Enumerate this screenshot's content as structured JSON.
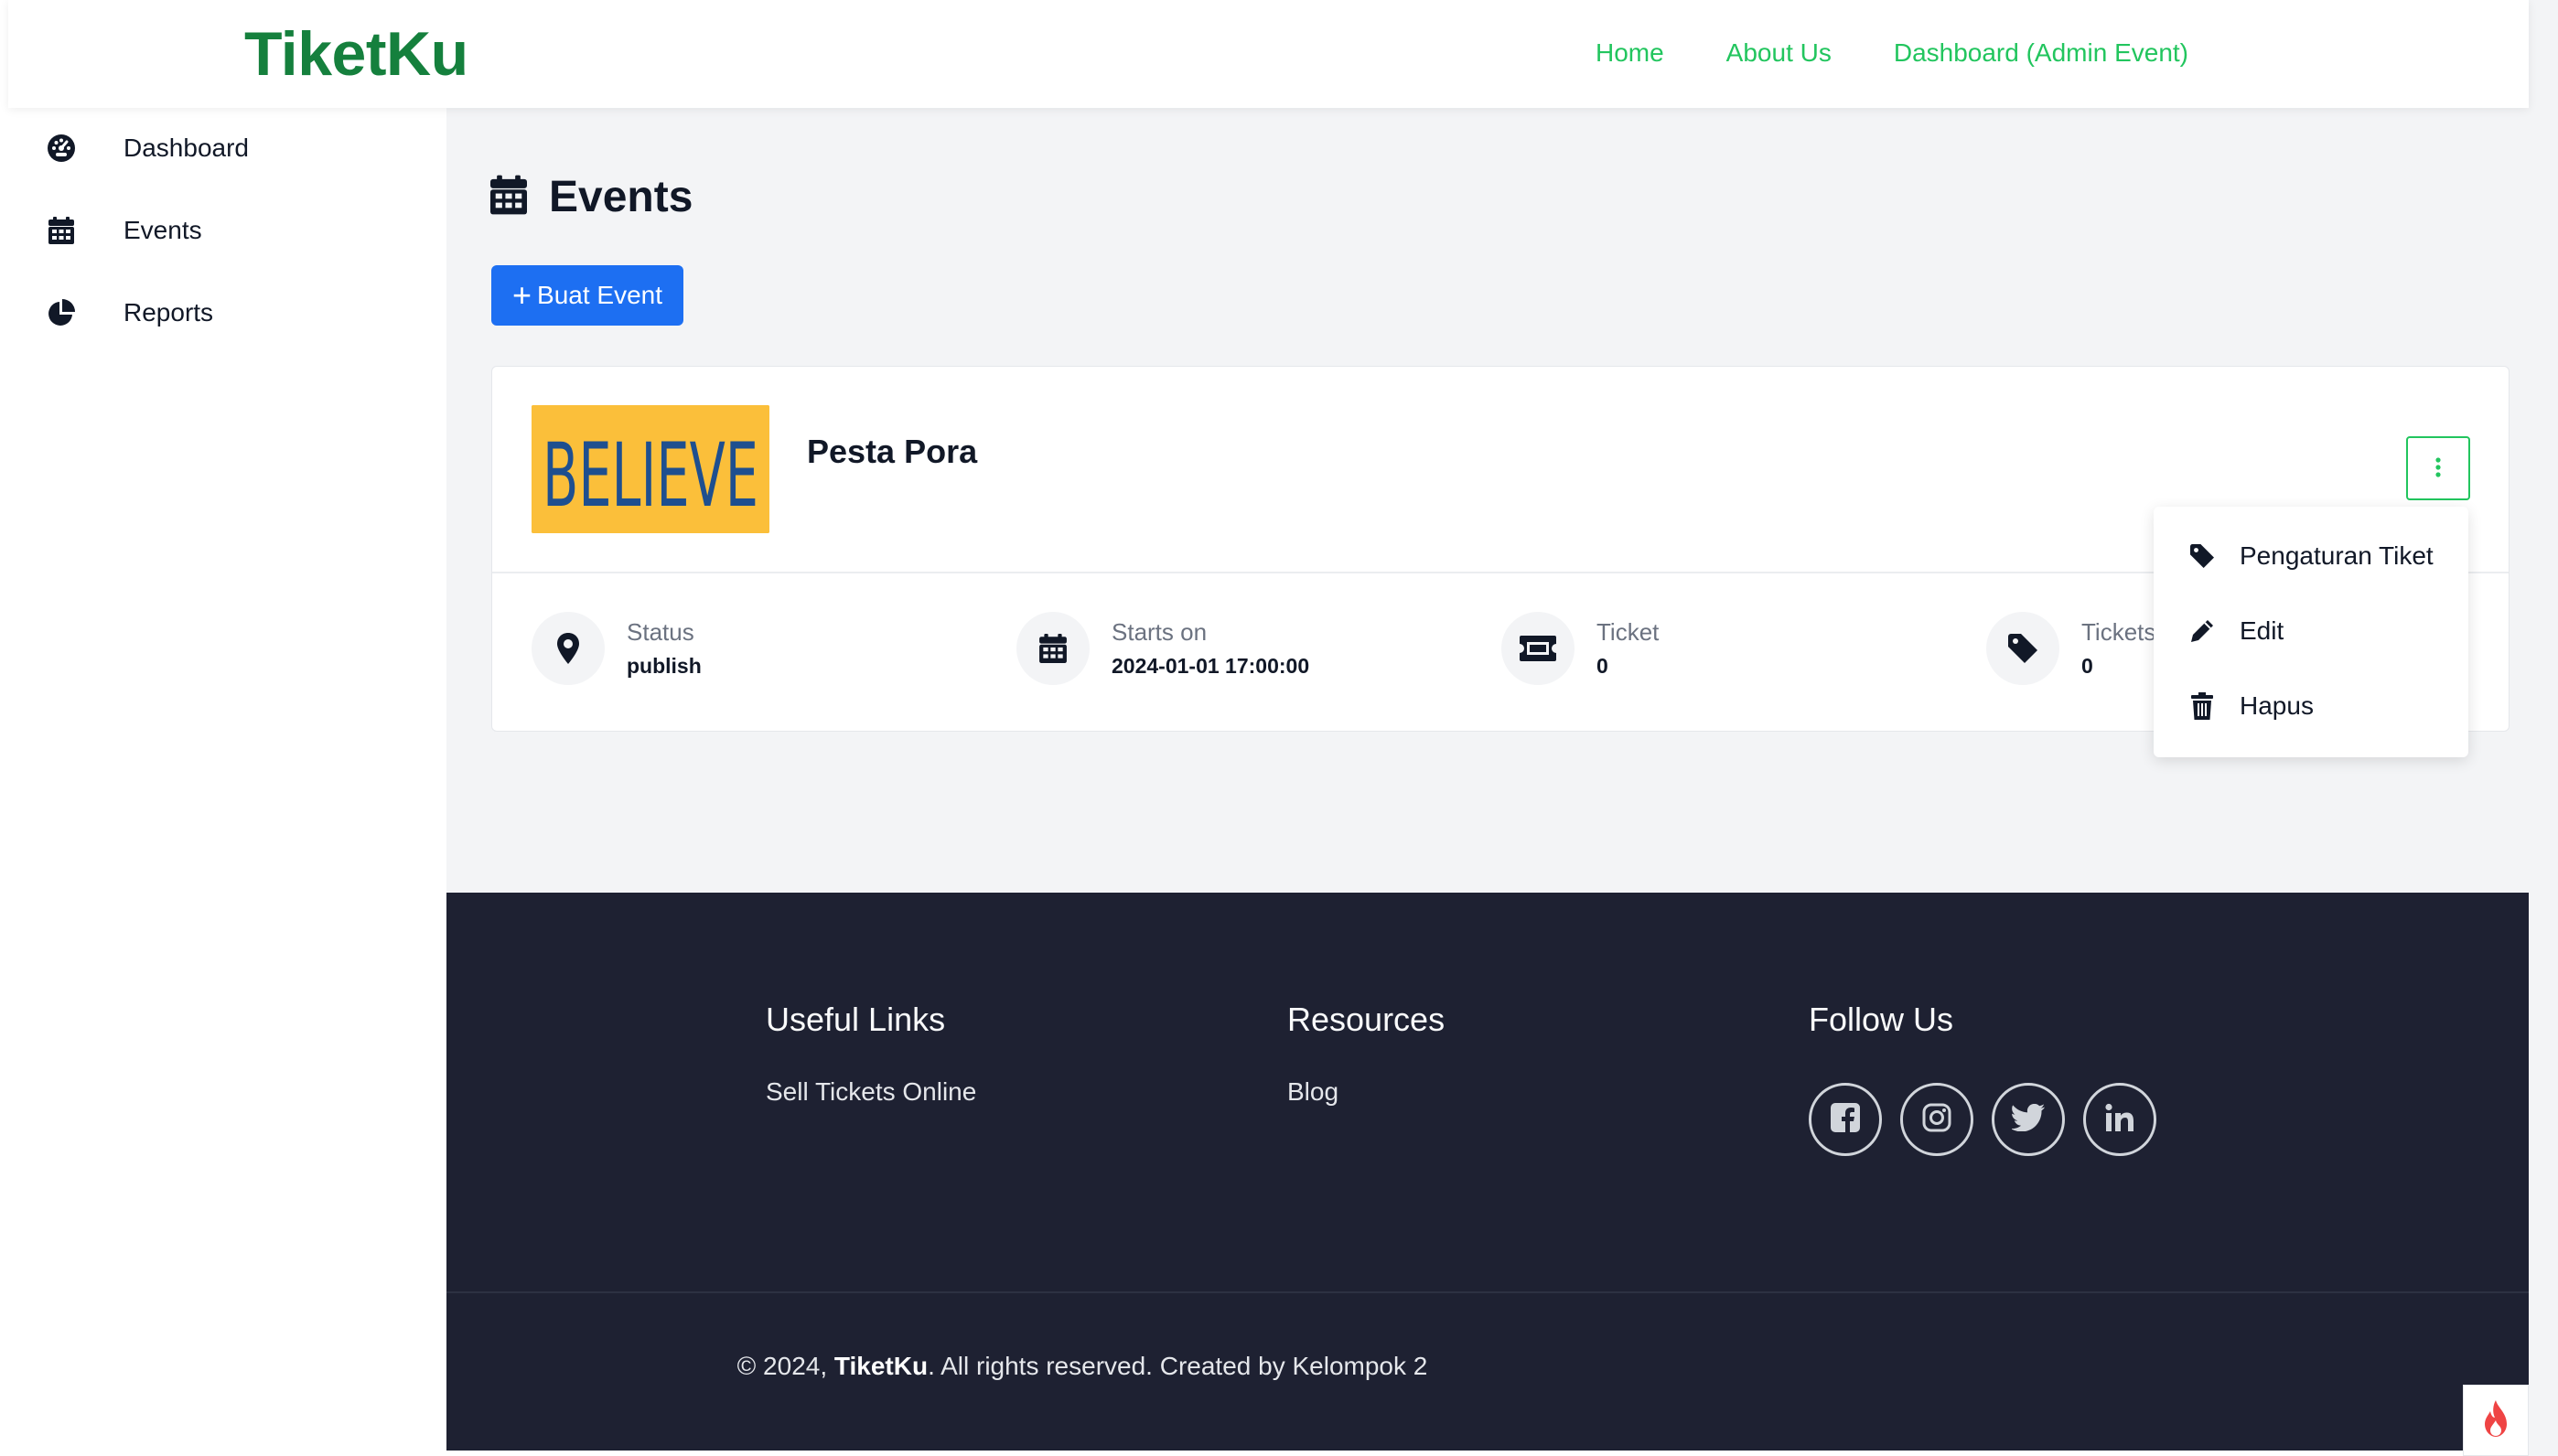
{
  "brand": {
    "name": "TiketKu",
    "color": "#15803d"
  },
  "nav": {
    "links": [
      "Home",
      "About Us",
      "Dashboard (Admin Event)"
    ],
    "color": "#22c55e"
  },
  "sidebar": {
    "items": [
      {
        "label": "Dashboard",
        "icon": "tachometer-icon"
      },
      {
        "label": "Events",
        "icon": "calendar-icon"
      },
      {
        "label": "Reports",
        "icon": "pie-chart-icon"
      }
    ]
  },
  "page": {
    "title": "Events",
    "title_icon": "calendar-icon",
    "create_button": "Buat Event",
    "create_button_color": "#1d6ff2"
  },
  "event": {
    "name": "Pesta Pora",
    "thumbnail_text": "BELIEVE",
    "meta": [
      {
        "label": "Status",
        "value": "publish",
        "icon": "map-pin-icon"
      },
      {
        "label": "Starts on",
        "value": "2024-01-01 17:00:00",
        "icon": "calendar-icon"
      },
      {
        "label": "Ticket",
        "value": "0",
        "icon": "ticket-icon"
      },
      {
        "label": "Tickets",
        "value": "0",
        "icon": "tag-icon"
      }
    ]
  },
  "dropdown": {
    "items": [
      {
        "label": "Pengaturan Tiket",
        "icon": "tag-icon"
      },
      {
        "label": "Edit",
        "icon": "pencil-icon"
      },
      {
        "label": "Hapus",
        "icon": "trash-icon"
      }
    ]
  },
  "footer": {
    "useful_links": {
      "title": "Useful Links",
      "items": [
        "Sell Tickets Online"
      ]
    },
    "resources": {
      "title": "Resources",
      "items": [
        "Blog"
      ]
    },
    "follow_us": {
      "title": "Follow Us",
      "socials": [
        "facebook-icon",
        "instagram-icon",
        "twitter-icon",
        "linkedin-icon"
      ]
    },
    "copyright": {
      "prefix": "© 2024, ",
      "brand": "TiketKu",
      "suffix": ". All rights reserved. Created by Kelompok 2"
    },
    "background": "#1e2132"
  }
}
